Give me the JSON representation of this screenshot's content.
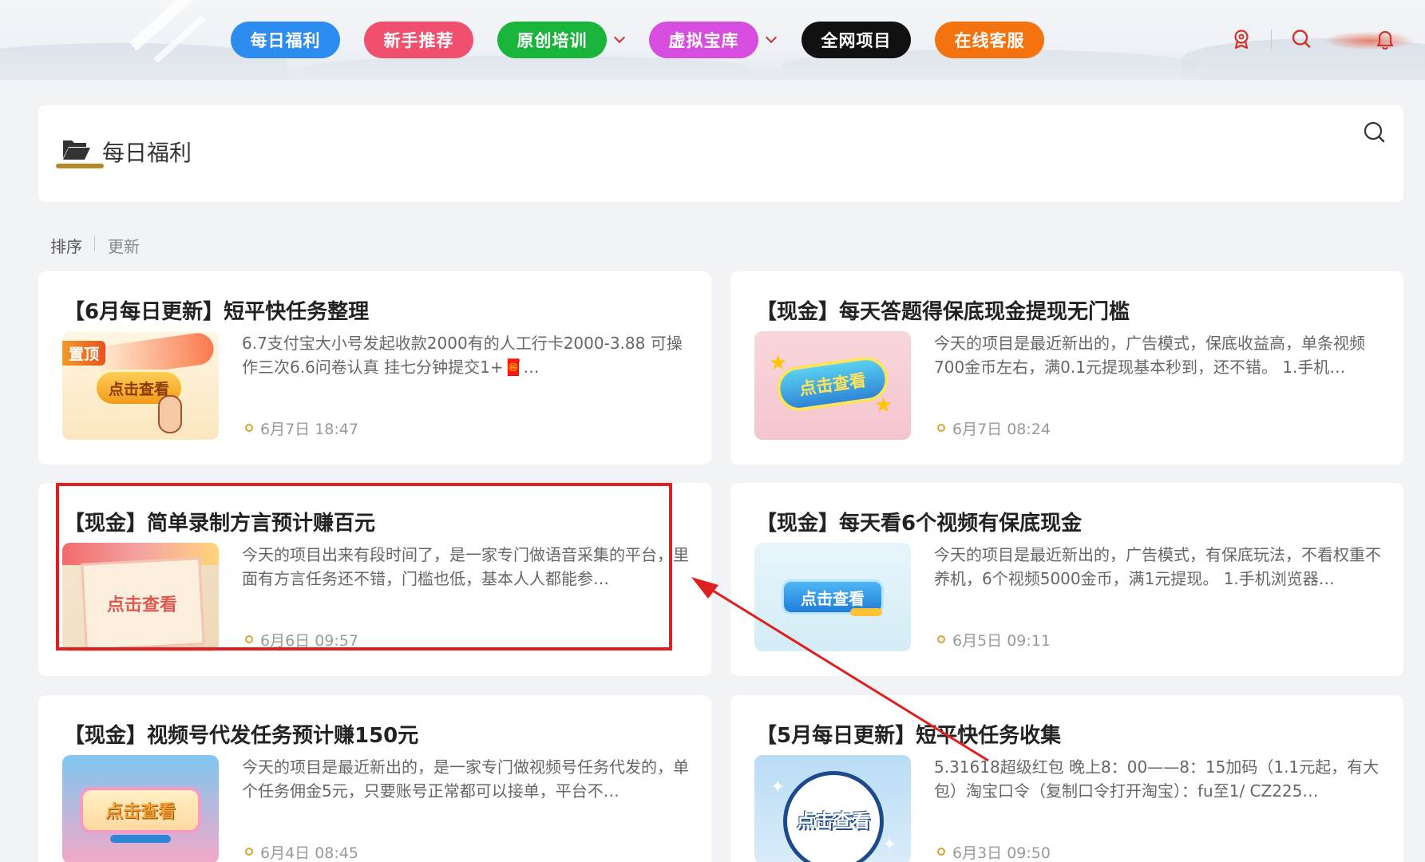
{
  "nav": {
    "items": [
      {
        "label": "每日福利",
        "color": "#2d8cf0"
      },
      {
        "label": "新手推荐",
        "color": "#f0506e"
      },
      {
        "label": "原创培训",
        "color": "#19b53a"
      },
      {
        "label": "虚拟宝库",
        "color": "#d64de0"
      },
      {
        "label": "全网项目",
        "color": "#111111"
      },
      {
        "label": "在线客服",
        "color": "#f4730f"
      }
    ],
    "icons": [
      "badge-icon",
      "search-icon",
      "bell-icon"
    ]
  },
  "header": {
    "title": "每日福利"
  },
  "sort": {
    "label": "排序",
    "option": "更新"
  },
  "posts": [
    {
      "title": "【6月每日更新】短平快任务整理",
      "desc": "6.7支付宝大小号发起收款2000有的人工行卡2000-3.88 可操作三次6.6问卷认真 挂七分钟提交1+🧧…",
      "date": "6月7日 18:47",
      "thumb_text": "点击查看",
      "pin": "置顶"
    },
    {
      "title": "【现金】每天答题得保底现金提现无门槛",
      "desc": "今天的项目是最近新出的，广告模式，保底收益高，单条视频700金币左右，满0.1元提现基本秒到，还不错。 1.手机…",
      "date": "6月7日 08:24",
      "thumb_text": "点击查看"
    },
    {
      "title": "【现金】简单录制方言预计赚百元",
      "desc": "今天的项目出来有段时间了，是一家专门做语音采集的平台，里面有方言任务还不错，门槛也低，基本人人都能参…",
      "date": "6月6日 09:57",
      "thumb_text": "点击查看"
    },
    {
      "title": "【现金】每天看6个视频有保底现金",
      "desc": "今天的项目是最近新出的，广告模式，有保底玩法，不看权重不养机，6个视频5000金币，满1元提现。 1.手机浏览器…",
      "date": "6月5日 09:11",
      "thumb_text": "点击查看"
    },
    {
      "title": "【现金】视频号代发任务预计赚150元",
      "desc": "今天的项目是最近新出的，是一家专门做视频号任务代发的，单个任务佣金5元，只要账号正常都可以接单，平台不…",
      "date": "6月4日 08:45",
      "thumb_text": "点击查看"
    },
    {
      "title": "【5月每日更新】短平快任务收集",
      "desc": "5.31618超级红包 晚上8：00——8：15加码（1.1元起，有大包）淘宝口令（复制口令打开淘宝）：fu至1/ CZ225…",
      "date": "6月3日 09:50",
      "thumb_text": "点击查看"
    }
  ]
}
